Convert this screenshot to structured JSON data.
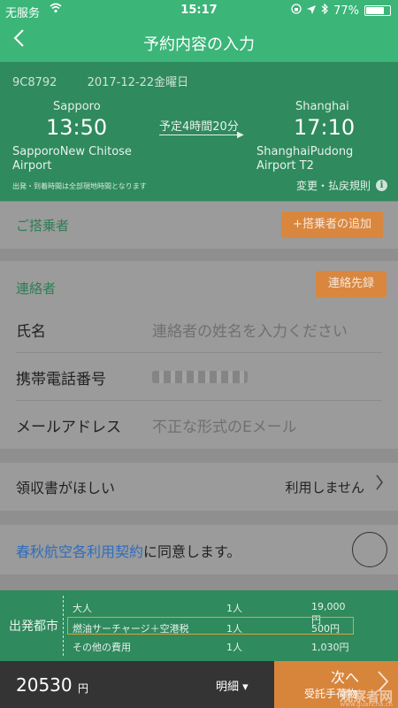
{
  "status": {
    "carrier": "无服务",
    "time": "15:17",
    "battery": "77%",
    "battery_level": 0.77
  },
  "nav": {
    "title": "予約内容の入力"
  },
  "flight": {
    "code": "9C8792",
    "date": "2017-12-22金曜日",
    "origin_city": "Sapporo",
    "depart_time": "13:50",
    "origin_airport_line1": "SapporoNew Chitose",
    "origin_airport_line2": "Airport",
    "duration": "予定4時間20分",
    "dest_city": "Shanghai",
    "arrive_time": "17:10",
    "dest_airport_line1": "ShanghaiPudong",
    "dest_airport_line2": "Airport T2",
    "note": "出発・到着時間は全部現地時間となります",
    "rules_label": "変更・払戻規則"
  },
  "passenger": {
    "label": "ご搭乗者",
    "add_button": "+搭乗者の追加"
  },
  "contact": {
    "label": "連絡者",
    "record_button": "連絡先録",
    "name_label": "氏名",
    "name_placeholder": "連絡者の姓名を入力ください",
    "phone_label": "携帯電話番号",
    "email_label": "メールアドレス",
    "email_placeholder": "不正な形式のEメール"
  },
  "receipt": {
    "label": "領収書がほしい",
    "value": "利用しません"
  },
  "agreement": {
    "link": "春秋航空各利用契約",
    "suffix": "に同意します。"
  },
  "price": {
    "city_label": "出発都市",
    "rows": [
      {
        "name": "大人",
        "qty": "1人",
        "amount": "19,000円"
      },
      {
        "name": "燃油サーチャージ＋空港税",
        "qty": "1人",
        "amount": "500円"
      },
      {
        "name": "その他の費用",
        "qty": "1人",
        "amount": "1,030円"
      }
    ]
  },
  "footer": {
    "total": "20530",
    "unit": "円",
    "detail": "明細",
    "next_line1": "次へ",
    "next_line2": "受託手荷物",
    "watermark": "观察者网",
    "watermark_sub": "www.guancha.cn"
  }
}
